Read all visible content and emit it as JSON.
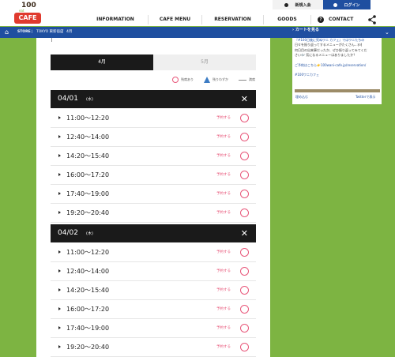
{
  "header": {
    "logo": {
      "number": "100",
      "name": "CAFE",
      "tag": "eat"
    },
    "nav": [
      "INFORMATION",
      "CAFE MENU",
      "RESERVATION",
      "GOODS",
      "CONTACT"
    ],
    "new_member": "新規入会",
    "login": "ログイン"
  },
  "breadcrumb": {
    "items": [
      "STORE",
      "TOKYO 東新宿店",
      "4月"
    ]
  },
  "cart_label": "カートを見る",
  "tabs": [
    "4月",
    "5月"
  ],
  "legend": {
    "available": "残席あり",
    "few": "残りわずか",
    "full": "満席"
  },
  "days": [
    {
      "date": "04/01",
      "weekday": "(水)",
      "slots": [
        {
          "time": "11:00〜12:20",
          "label": "予約する"
        },
        {
          "time": "12:40〜14:00",
          "label": "予約する"
        },
        {
          "time": "14:20〜15:40",
          "label": "予約する"
        },
        {
          "time": "16:00〜17:20",
          "label": "予約する"
        },
        {
          "time": "17:40〜19:00",
          "label": "予約する"
        },
        {
          "time": "19:20〜20:40",
          "label": "予約する"
        }
      ]
    },
    {
      "date": "04/02",
      "weekday": "(木)",
      "slots": [
        {
          "time": "11:00〜12:20",
          "label": "予約する"
        },
        {
          "time": "12:40〜14:00",
          "label": "予約する"
        },
        {
          "time": "14:20〜15:40",
          "label": "予約する"
        },
        {
          "time": "16:00〜17:20",
          "label": "予約する"
        },
        {
          "time": "17:40〜19:00",
          "label": "予約する"
        },
        {
          "time": "19:20〜20:40",
          "label": "予約する"
        }
      ]
    }
  ],
  "sidebar": {
    "line1": "『#100日後に死ぬワニ カフェ』ではワニたちの",
    "line2": "日々を振り返ってするメニューがたくさん…🍽",
    "line3": "何日目の出来事だったか、ぜひ振り返ってみてくだ",
    "line4": "さい🎶 気になるメニューはありましたか？",
    "line5": "ご予約はこちら👉100wani-cafe.jp/reservation/",
    "line6": "#100ワニカフェ",
    "embed": "埋め込む",
    "view_on_twitter": "Twitterで表示"
  }
}
